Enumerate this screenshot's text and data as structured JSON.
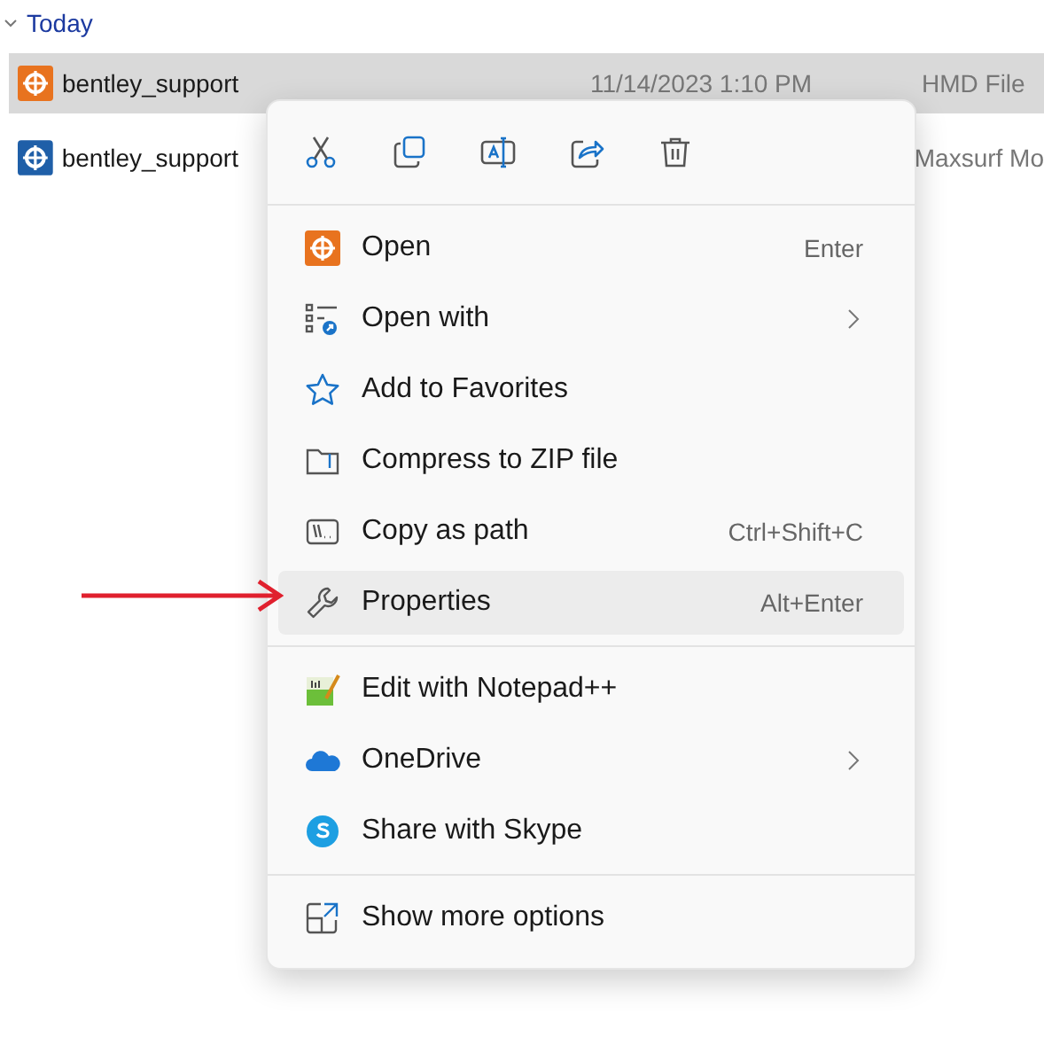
{
  "group": {
    "label": "Today",
    "expanded": true
  },
  "files": [
    {
      "name": "bentley_support",
      "date": "11/14/2023 1:10 PM",
      "type": "HMD File",
      "selected": true,
      "color": "#e8731f"
    },
    {
      "name": "bentley_support",
      "type": "Maxsurf Mo",
      "selected": false,
      "color": "#1f5fa8"
    }
  ],
  "menu": {
    "sections": [
      [
        {
          "label": "Open",
          "shortcut": "Enter",
          "submenu": false,
          "selected": false
        },
        {
          "label": "Open with",
          "submenu": true,
          "selected": false
        },
        {
          "label": "Add to Favorites",
          "submenu": false,
          "selected": false
        },
        {
          "label": "Compress to ZIP file",
          "submenu": false,
          "selected": false
        },
        {
          "label": "Copy as path",
          "shortcut": "Ctrl+Shift+C",
          "submenu": false,
          "selected": false
        },
        {
          "label": "Properties",
          "shortcut": "Alt+Enter",
          "submenu": false,
          "selected": true
        }
      ],
      [
        {
          "label": "Edit with Notepad++",
          "submenu": false,
          "selected": false
        },
        {
          "label": "OneDrive",
          "submenu": true,
          "selected": false
        },
        {
          "label": "Share with Skype",
          "submenu": false,
          "selected": false
        }
      ],
      [
        {
          "label": "Show more options",
          "submenu": false,
          "selected": false
        }
      ]
    ]
  }
}
